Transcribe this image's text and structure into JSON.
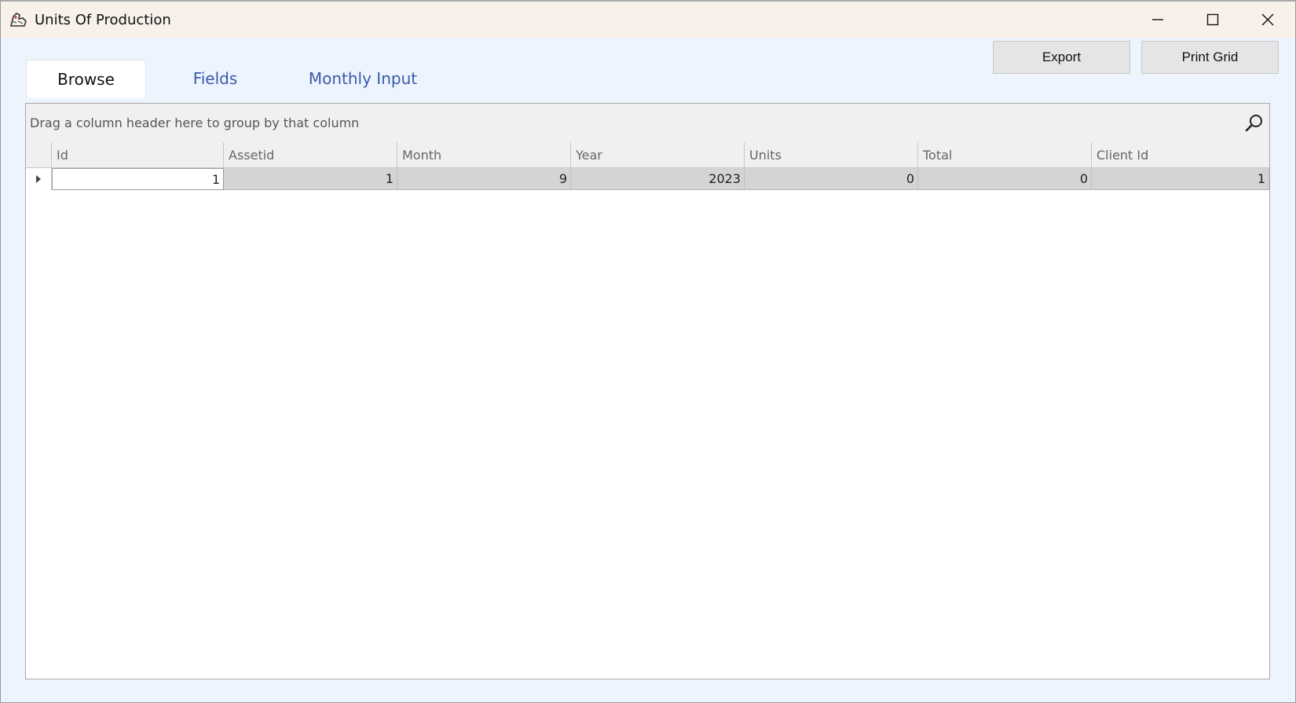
{
  "window": {
    "title": "Units Of Production"
  },
  "tabs": [
    {
      "label": "Browse",
      "active": true
    },
    {
      "label": "Fields",
      "active": false
    },
    {
      "label": "Monthly Input",
      "active": false
    }
  ],
  "toolbar": {
    "export_label": "Export",
    "print_label": "Print Grid"
  },
  "grid": {
    "group_hint": "Drag a column header here to group by that column",
    "columns": [
      "Id",
      "Assetid",
      "Month",
      "Year",
      "Units",
      "Total",
      "Client Id"
    ],
    "rows": [
      [
        "1",
        "1",
        "9",
        "2023",
        "0",
        "0",
        "1"
      ]
    ]
  },
  "icons": {
    "app": "app-logo-icon",
    "minimize": "minimize-icon",
    "maximize": "maximize-icon",
    "close": "close-icon",
    "search": "search-icon",
    "row_indicator": "row-indicator-icon"
  },
  "colors": {
    "tab_link": "#3a5aaa",
    "titlebar": "#f7f1ea",
    "background": "#eef4fd"
  }
}
